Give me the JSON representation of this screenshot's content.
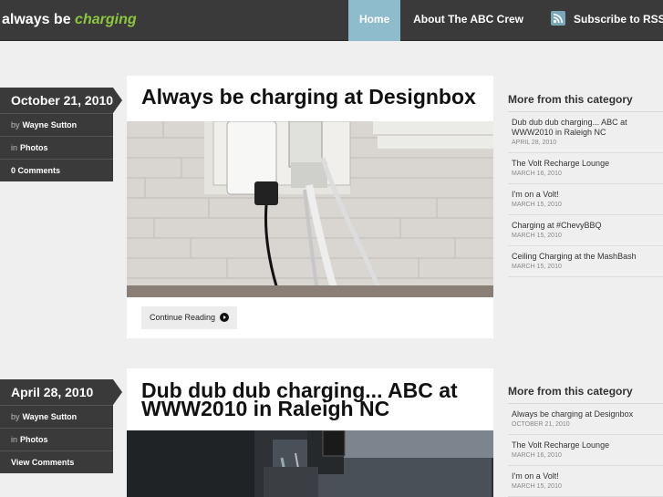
{
  "header": {
    "logo_main": "always be ",
    "logo_accent": "charging",
    "nav": {
      "home": "Home",
      "about": "About The ABC Crew",
      "subscribe": "Subscribe to RSS"
    }
  },
  "posts": [
    {
      "date": "October 21, 2010",
      "author_prefix": "by",
      "author": "Wayne Sutton",
      "category_prefix": "in",
      "category": "Photos",
      "comments": "0 Comments",
      "title": "Always be charging at Designbox",
      "continue_label": "Continue Reading"
    },
    {
      "date": "April 28, 2010",
      "author_prefix": "by",
      "author": "Wayne Sutton",
      "category_prefix": "in",
      "category": "Photos",
      "comments": "View Comments",
      "title": "Dub dub dub charging... ABC at WWW2010 in Raleigh NC"
    }
  ],
  "widgets": [
    {
      "heading": "More from this category",
      "items": [
        {
          "title": "Dub dub dub charging... ABC at WWW2010 in Raleigh NC",
          "date": "April 28, 2010"
        },
        {
          "title": "The Volt Recharge Lounge",
          "date": "March 16, 2010"
        },
        {
          "title": "I'm on a Volt!",
          "date": "March 15, 2010"
        },
        {
          "title": "Charging at #ChevyBBQ",
          "date": "March 15, 2010"
        },
        {
          "title": "Ceiling Charging at the MashBash",
          "date": "March 15, 2010"
        }
      ]
    },
    {
      "heading": "More from this category",
      "items": [
        {
          "title": "Always be charging at Designbox",
          "date": "October 21, 2010"
        },
        {
          "title": "The Volt Recharge Lounge",
          "date": "March 16, 2010"
        },
        {
          "title": "I'm on a Volt!",
          "date": "March 15, 2010"
        }
      ]
    }
  ],
  "icons": {
    "rss": "rss-icon",
    "continue": "arrow-right-circle-icon"
  },
  "colors": {
    "topbar": "#3a3a3a",
    "accent_green": "#8cc63f",
    "nav_active": "#8fbccc"
  }
}
